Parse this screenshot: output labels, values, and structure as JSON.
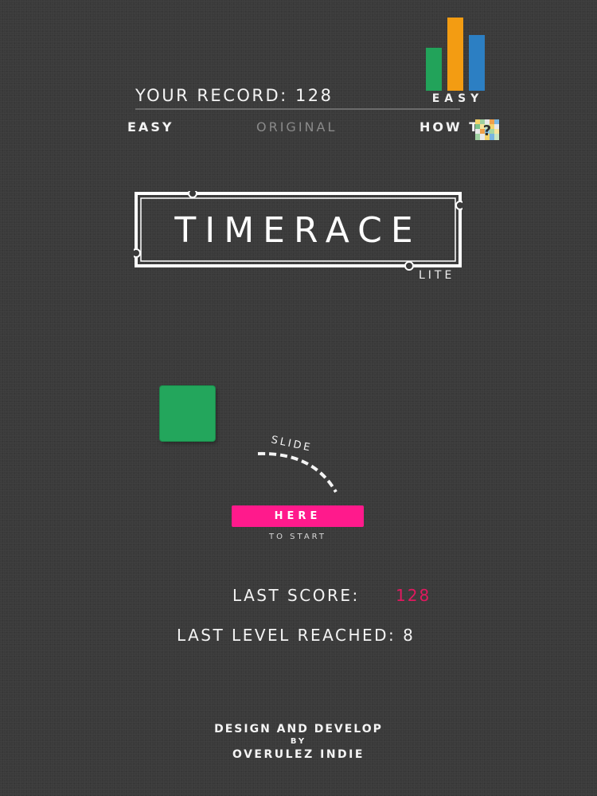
{
  "header": {
    "record_label": "YOUR RECORD:",
    "record_value": "128",
    "difficulty_label": "EASY"
  },
  "modes": {
    "easy": "EASY",
    "original": "ORIGINAL",
    "howto": "HOW TO"
  },
  "title": {
    "main": "TIMERACE",
    "sub": "LITE"
  },
  "start": {
    "slide_text": "SLIDE",
    "button": "HERE",
    "caption": "TO START"
  },
  "stats": {
    "last_score_label": "LAST SCORE:",
    "last_score_value": "128",
    "last_level": "LAST LEVEL REACHED: 8"
  },
  "credits": {
    "line1": "DESIGN AND DEVELOP",
    "line2": "BY",
    "line3": "OVERULEZ INDIE"
  },
  "colors": {
    "background": "#3a3a3a",
    "accent_pink": "#ff1a8c",
    "score_red": "#e0195f",
    "green": "#23a65c",
    "orange": "#f39c12",
    "blue": "#2c7fc3"
  },
  "icons": {
    "difficulty": "difficulty-bars-icon",
    "help": "pixel-question-icon"
  }
}
